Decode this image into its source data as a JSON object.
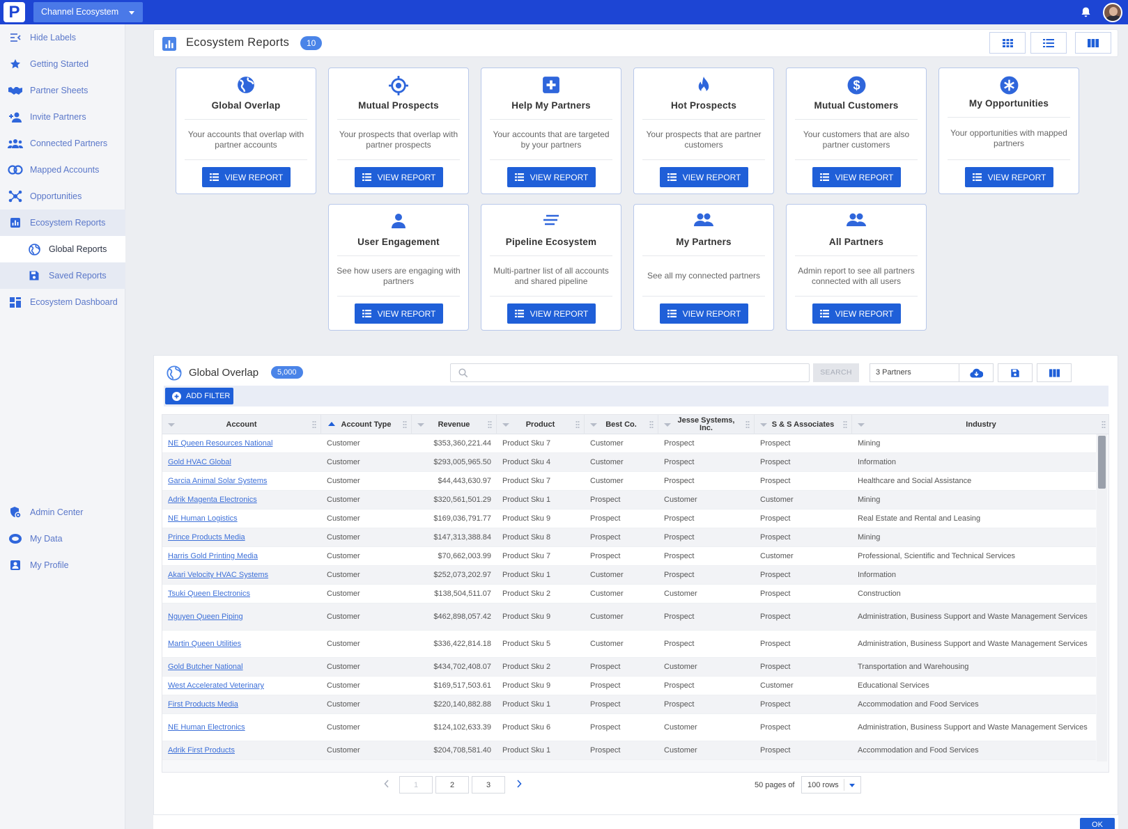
{
  "topbar": {
    "logo": "P",
    "workspace": "Channel Ecosystem"
  },
  "sidebar": {
    "items": [
      {
        "label": "Hide Labels",
        "icon": "hide-labels-icon"
      },
      {
        "label": "Getting Started",
        "icon": "star-icon"
      },
      {
        "label": "Partner Sheets",
        "icon": "handshake-icon"
      },
      {
        "label": "Invite Partners",
        "icon": "add-user-icon"
      },
      {
        "label": "Connected Partners",
        "icon": "users-icon"
      },
      {
        "label": "Mapped Accounts",
        "icon": "overlap-circles-icon"
      },
      {
        "label": "Opportunities",
        "icon": "network-icon"
      },
      {
        "label": "Ecosystem Reports",
        "icon": "bar-chart-icon"
      },
      {
        "label": "Global Reports",
        "icon": "globe-icon"
      },
      {
        "label": "Saved Reports",
        "icon": "save-icon"
      },
      {
        "label": "Ecosystem Dashboard",
        "icon": "dashboard-icon"
      },
      {
        "label": "Admin Center",
        "icon": "admin-shield-icon"
      },
      {
        "label": "My Data",
        "icon": "database-icon"
      },
      {
        "label": "My Profile",
        "icon": "profile-card-icon"
      }
    ]
  },
  "reports": {
    "title": "Ecosystem Reports",
    "count": "10",
    "view_label": "VIEW REPORT",
    "cards": [
      {
        "title": "Global Overlap",
        "desc": "Your accounts that overlap with partner accounts",
        "icon": "globe-icon"
      },
      {
        "title": "Mutual Prospects",
        "desc": "Your prospects that overlap with partner prospects",
        "icon": "crosshair-icon"
      },
      {
        "title": "Help My Partners",
        "desc": "Your accounts that are targeted by your partners",
        "icon": "medical-plus-icon"
      },
      {
        "title": "Hot Prospects",
        "desc": "Your prospects that are partner customers",
        "icon": "fire-icon"
      },
      {
        "title": "Mutual Customers",
        "desc": "Your customers that are also partner customers",
        "icon": "dollar-icon"
      },
      {
        "title": "My Opportunities",
        "desc": "Your opportunities with mapped partners",
        "icon": "asterisk-circle-icon"
      },
      {
        "title": "User Engagement",
        "desc": "See how users are engaging with partners",
        "icon": "user-icon"
      },
      {
        "title": "Pipeline Ecosystem",
        "desc": "Multi-partner list of all accounts and shared pipeline",
        "icon": "lines-icon"
      },
      {
        "title": "My Partners",
        "desc": "See all my connected partners",
        "icon": "people-icon"
      },
      {
        "title": "All Partners",
        "desc": "Admin report to see all partners connected with all users",
        "icon": "people-icon"
      }
    ]
  },
  "table": {
    "title": "Global Overlap",
    "count": "5,000",
    "search_placeholder": "",
    "search_button": "SEARCH",
    "partners_select": "3 Partners",
    "add_filter": "ADD FILTER",
    "columns": [
      "Account",
      "Account Type",
      "Revenue",
      "Product",
      "Best Co.",
      "Jesse Systems, Inc.",
      "S & S Associates",
      "Industry"
    ],
    "rows": [
      [
        "NE Queen Resources National",
        "Customer",
        "$353,360,221.44",
        "Product Sku 7",
        "Customer",
        "Prospect",
        "Prospect",
        "Mining"
      ],
      [
        "Gold HVAC Global",
        "Customer",
        "$293,005,965.50",
        "Product Sku 4",
        "Customer",
        "Prospect",
        "Prospect",
        "Information"
      ],
      [
        "Garcia Animal Solar Systems",
        "Customer",
        "$44,443,630.97",
        "Product Sku 7",
        "Customer",
        "Prospect",
        "Prospect",
        "Healthcare and Social Assistance"
      ],
      [
        "Adrik Magenta Electronics",
        "Customer",
        "$320,561,501.29",
        "Product Sku 1",
        "Prospect",
        "Customer",
        "Customer",
        "Mining"
      ],
      [
        "NE Human Logistics",
        "Customer",
        "$169,036,791.77",
        "Product Sku 9",
        "Prospect",
        "Prospect",
        "Prospect",
        "Real Estate and Rental and Leasing"
      ],
      [
        "Prince Products Media",
        "Customer",
        "$147,313,388.84",
        "Product Sku 8",
        "Prospect",
        "Prospect",
        "Prospect",
        "Mining"
      ],
      [
        "Harris Gold Printing Media",
        "Customer",
        "$70,662,003.99",
        "Product Sku 7",
        "Prospect",
        "Prospect",
        "Customer",
        "Professional, Scientific and Technical Services"
      ],
      [
        "Akari Velocity HVAC Systems",
        "Customer",
        "$252,073,202.97",
        "Product Sku 1",
        "Customer",
        "Prospect",
        "Prospect",
        "Information"
      ],
      [
        "Tsuki Queen Electronics",
        "Customer",
        "$138,504,511.07",
        "Product Sku 2",
        "Customer",
        "Customer",
        "Prospect",
        "Construction"
      ],
      [
        "Nguyen Queen Piping",
        "Customer",
        "$462,898,057.42",
        "Product Sku 9",
        "Customer",
        "Prospect",
        "Prospect",
        "Administration, Business Support and Waste Management Services"
      ],
      [
        "Martin Queen Utilities",
        "Customer",
        "$336,422,814.18",
        "Product Sku 5",
        "Customer",
        "Prospect",
        "Prospect",
        "Administration, Business Support and Waste Management Services"
      ],
      [
        "Gold Butcher National",
        "Customer",
        "$434,702,408.07",
        "Product Sku 2",
        "Prospect",
        "Customer",
        "Prospect",
        "Transportation and Warehousing"
      ],
      [
        "West Accelerated Veterinary",
        "Customer",
        "$169,517,503.61",
        "Product Sku 9",
        "Prospect",
        "Prospect",
        "Customer",
        "Educational Services"
      ],
      [
        "First Products Media",
        "Customer",
        "$220,140,882.88",
        "Product Sku 1",
        "Prospect",
        "Prospect",
        "Prospect",
        "Accommodation and Food Services"
      ],
      [
        "NE Human Electronics",
        "Customer",
        "$124,102,633.39",
        "Product Sku 6",
        "Prospect",
        "Customer",
        "Prospect",
        "Administration, Business Support and Waste Management Services"
      ],
      [
        "Adrik First Products",
        "Customer",
        "$204,708,581.40",
        "Product Sku 1",
        "Prospect",
        "Customer",
        "Prospect",
        "Accommodation and Food Services"
      ]
    ]
  },
  "pager": {
    "pages": [
      "1",
      "2",
      "3"
    ],
    "info": "50 pages of",
    "rows": "100 rows"
  },
  "footer": {
    "ok": "OK"
  },
  "colors": {
    "brand": "#1d45d4",
    "accent": "#1f5fd8",
    "link": "#3c6fd8",
    "icon": "#2f66db"
  }
}
